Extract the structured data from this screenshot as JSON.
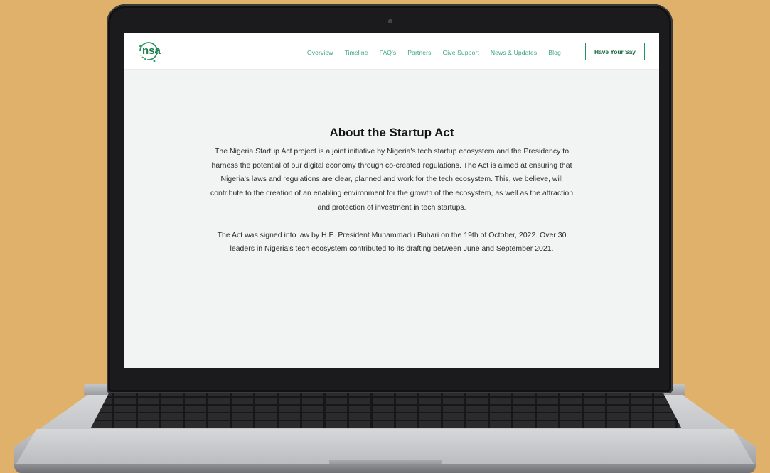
{
  "site": {
    "logo_text": "nsa"
  },
  "nav": {
    "items": [
      {
        "label": "Overview"
      },
      {
        "label": "Timeline"
      },
      {
        "label": "FAQ's"
      },
      {
        "label": "Partners"
      },
      {
        "label": "Give Support"
      },
      {
        "label": "News & Updates"
      },
      {
        "label": "Blog"
      }
    ],
    "cta_label": "Have Your Say"
  },
  "main": {
    "title": "About the Startup Act",
    "paragraph_1": "The Nigeria Startup Act project is a joint initiative by Nigeria's tech startup ecosystem and the Presidency to harness the potential of our digital economy through co-created regulations. The Act is aimed at ensuring that Nigeria's laws and regulations are clear, planned and work for the tech ecosystem. This, we believe, will contribute to the creation of an enabling environment for the growth of the ecosystem, as well as the attraction and protection of investment in tech startups.",
    "paragraph_2": "The Act was signed into law by H.E. President Muhammadu Buhari on the 19th of October, 2022. Over 30 leaders in Nigeria's tech ecosystem contributed to its drafting between June and September 2021."
  },
  "colors": {
    "background": "#dfb16a",
    "brand_green": "#21935f",
    "nav_link": "#3aa57d",
    "page_bg": "#f2f3f3"
  }
}
